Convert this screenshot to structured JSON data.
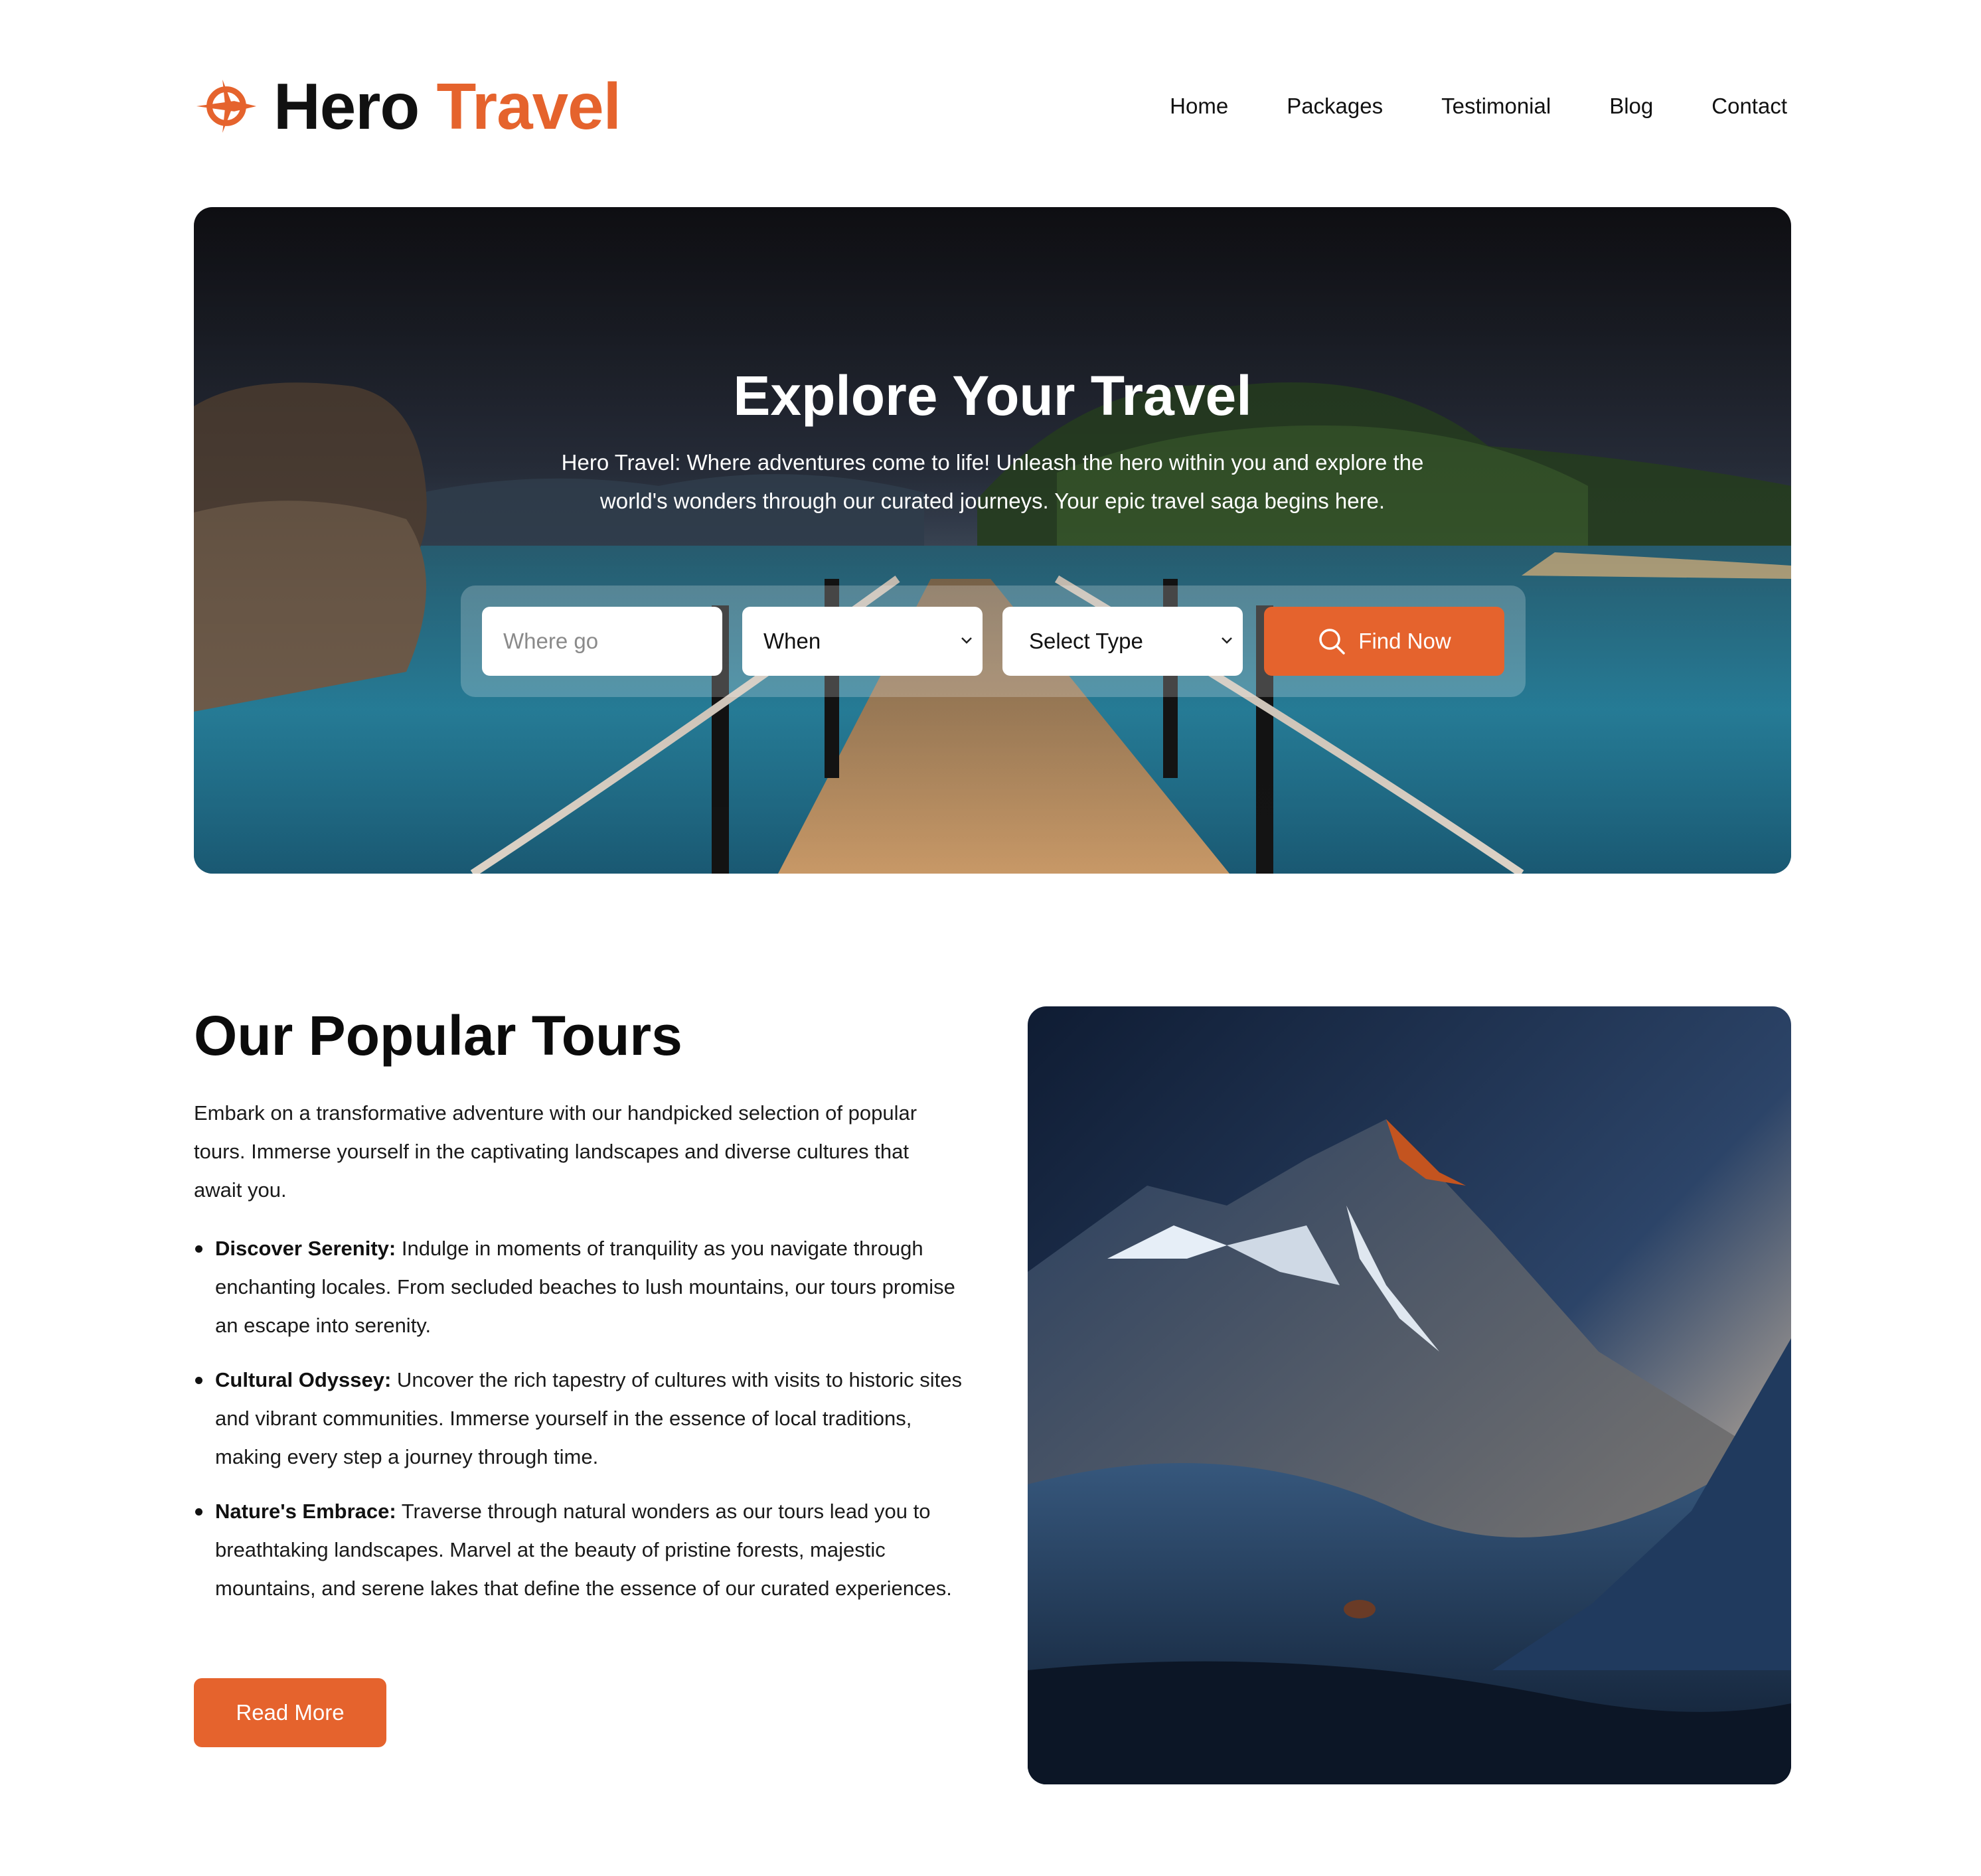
{
  "header": {
    "logo_word1": "Hero",
    "logo_word2": "Travel",
    "logo_icon": "compass-plane-icon",
    "nav": [
      "Home",
      "Packages",
      "Testimonial",
      "Blog",
      "Contact"
    ]
  },
  "hero": {
    "title": "Explore Your Travel",
    "subtitle": "Hero Travel: Where adventures come to life! Unleash the hero within you and explore the world's wonders through our curated journeys. Your epic travel saga begins here.",
    "search": {
      "where_placeholder": "Where go",
      "when_value": "When",
      "type_value": "Select Type",
      "button_label": "Find Now",
      "button_icon": "search-icon"
    }
  },
  "tours": {
    "title": "Our Popular Tours",
    "intro": "Embark on a transformative adventure with our handpicked selection of popular tours. Immerse yourself in the captivating landscapes and diverse cultures that await you.",
    "items": [
      {
        "heading": "Discover Serenity:",
        "text": " Indulge in moments of tranquility as you navigate through enchanting locales. From secluded beaches to lush mountains, our tours promise an escape into serenity."
      },
      {
        "heading": "Cultural Odyssey:",
        "text": " Uncover the rich tapestry of cultures with visits to historic sites and vibrant communities. Immerse yourself in the essence of local traditions, making every step a journey through time."
      },
      {
        "heading": "Nature's Embrace:",
        "text": " Traverse through natural wonders as our tours lead you to breathtaking landscapes. Marvel at the beauty of pristine forests, majestic mountains, and serene lakes that define the essence of our curated experiences."
      }
    ],
    "read_more": "Read More"
  },
  "colors": {
    "accent": "#e5632d",
    "text": "#111111",
    "background": "#ffffff"
  }
}
